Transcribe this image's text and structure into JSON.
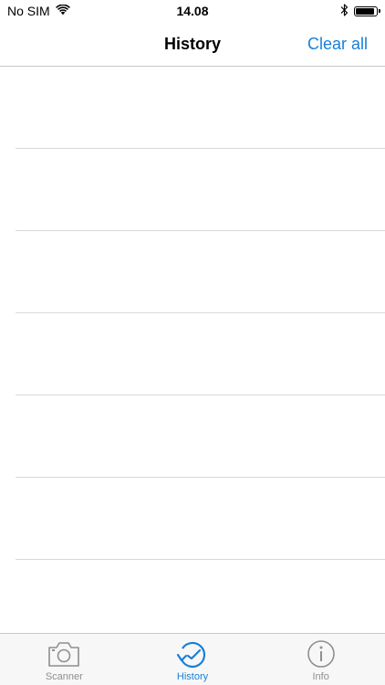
{
  "status_bar": {
    "carrier": "No SIM",
    "time": "14.08",
    "battery_level": 0.9
  },
  "nav": {
    "title": "History",
    "clear_label": "Clear all"
  },
  "list": {
    "rows": [
      "",
      "",
      "",
      "",
      "",
      "",
      ""
    ]
  },
  "tabs": [
    {
      "label": "Scanner",
      "icon": "camera-icon",
      "active": false
    },
    {
      "label": "History",
      "icon": "history-icon",
      "active": true
    },
    {
      "label": "Info",
      "icon": "info-icon",
      "active": false
    }
  ],
  "colors": {
    "accent": "#1a7fd8",
    "inactive": "#8e8e93",
    "separator": "#d9d9dc",
    "tab_bar_bg": "#f7f7f7"
  }
}
